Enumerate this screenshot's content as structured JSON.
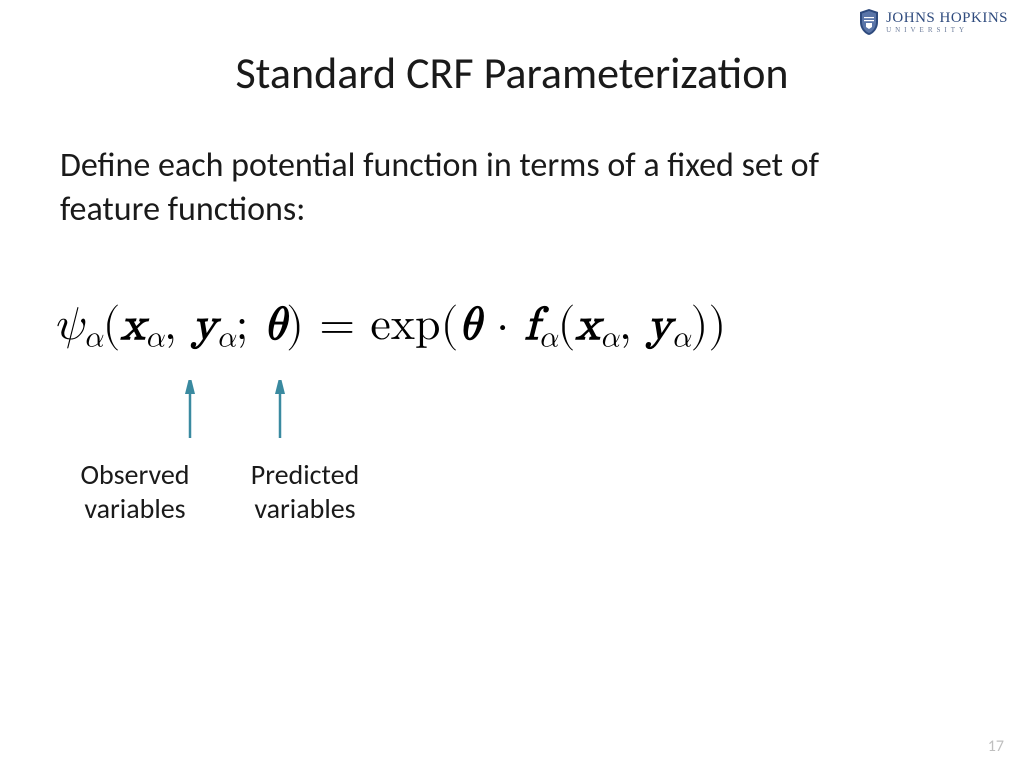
{
  "logo": {
    "name_line1": "JOHNS HOPKINS",
    "name_line2": "UNIVERSITY"
  },
  "title": "Standard CRF Parameterization",
  "intro": "Define each potential function in terms of a fixed set of feature functions:",
  "equation": {
    "lhs_fn": "ψ",
    "sub": "α",
    "x": "x",
    "y": "y",
    "theta": "θ",
    "eq_text": " = ",
    "exp_text": "exp",
    "f": "f"
  },
  "labels": {
    "observed": "Observed\nvariables",
    "predicted": "Predicted\nvariables"
  },
  "page_number": "17"
}
